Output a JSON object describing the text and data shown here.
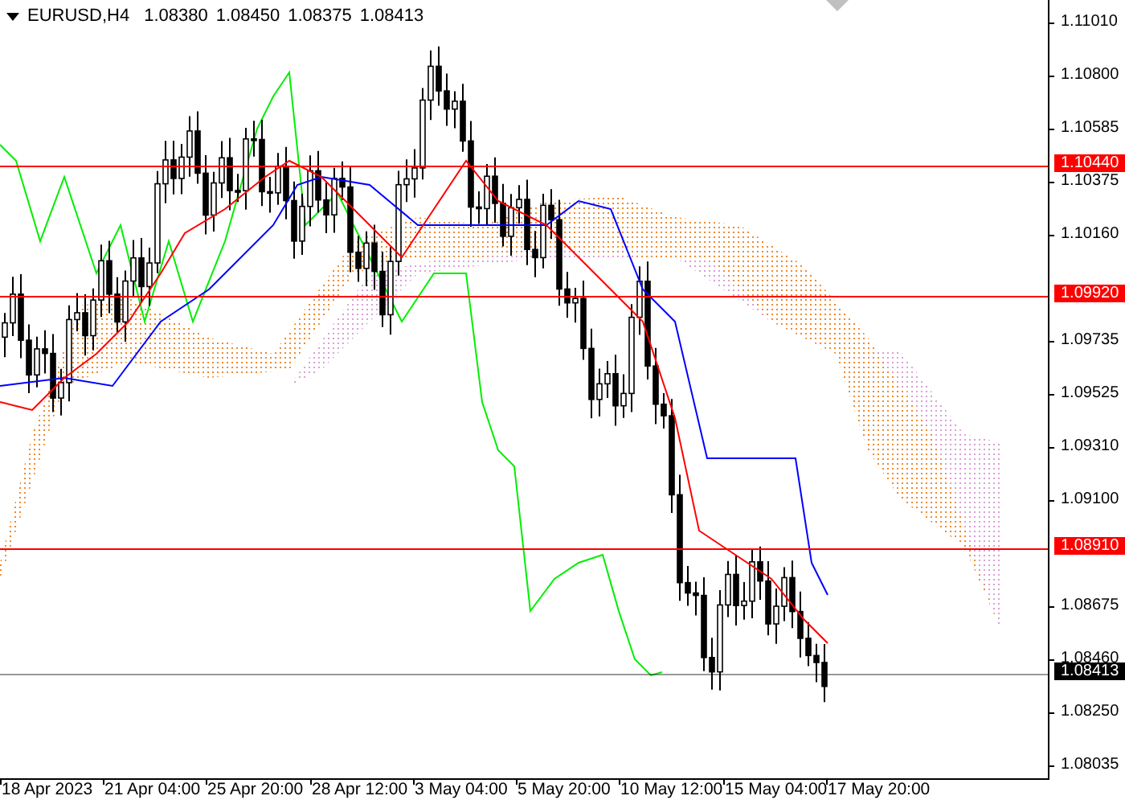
{
  "header": {
    "symbol": "EURUSD,H4",
    "open": "1.08380",
    "high": "1.08450",
    "low": "1.08375",
    "close": "1.08413"
  },
  "price_axis": [
    "1.11010",
    "1.10800",
    "1.10585",
    "1.10375",
    "1.10160",
    "1.09735",
    "1.09525",
    "1.09310",
    "1.09100",
    "1.08675",
    "1.08460",
    "1.08250",
    "1.08035"
  ],
  "price_levels": [
    {
      "label": "1.10440",
      "kind": "line",
      "color": "#ff0000"
    },
    {
      "label": "1.09920",
      "kind": "line",
      "color": "#ff0000"
    },
    {
      "label": "1.08910",
      "kind": "line",
      "color": "#ff0000"
    },
    {
      "label": "1.08413",
      "kind": "bid",
      "color": "#000000"
    }
  ],
  "time_axis": [
    "18 Apr 2023",
    "21 Apr 04:00",
    "25 Apr 20:00",
    "28 Apr 12:00",
    "3 May 04:00",
    "5 May 20:00",
    "10 May 12:00",
    "15 May 04:00",
    "17 May 20:00"
  ]
}
